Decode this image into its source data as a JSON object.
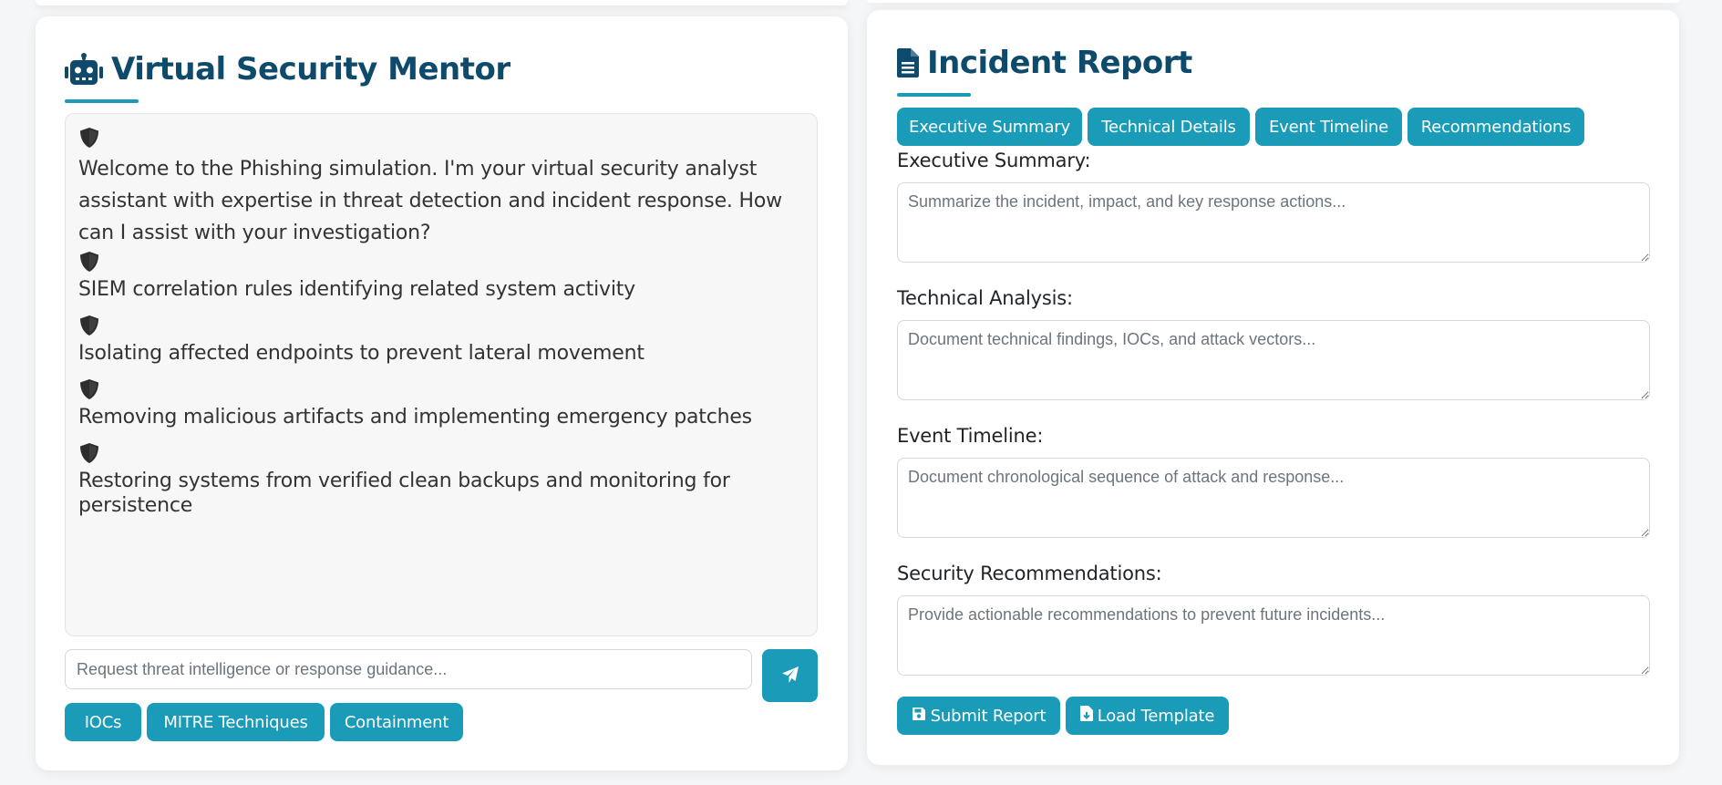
{
  "mentor": {
    "title": "Virtual Security Mentor",
    "messages": [
      {
        "avatar_icon": "shield-icon",
        "text": "Welcome to the Phishing simulation. I'm your virtual security analyst assistant with expertise in threat detection and incident response. How can I assist with your investigation?"
      },
      {
        "avatar_icon": "shield-icon",
        "text": "SIEM correlation rules identifying related system activity"
      },
      {
        "avatar_icon": "shield-icon",
        "text": "Isolating affected endpoints to prevent lateral movement"
      },
      {
        "avatar_icon": "shield-icon",
        "text": "Removing malicious artifacts and implementing emergency patches"
      },
      {
        "avatar_icon": "shield-icon",
        "text": "Restoring systems from verified clean backups and monitoring for persistence"
      }
    ],
    "input": {
      "value": "",
      "placeholder": "Request threat intelligence or response guidance..."
    },
    "send_icon": "paper-plane-icon",
    "quick_actions": [
      "IOCs",
      "MITRE Techniques",
      "Containment"
    ]
  },
  "report": {
    "title": "Incident Report",
    "tabs": [
      "Executive Summary",
      "Technical Details",
      "Event Timeline",
      "Recommendations"
    ],
    "fields": [
      {
        "label": "Executive Summary:",
        "placeholder": "Summarize the incident, impact, and key response actions...",
        "value": ""
      },
      {
        "label": "Technical Analysis:",
        "placeholder": "Document technical findings, IOCs, and attack vectors...",
        "value": ""
      },
      {
        "label": "Event Timeline:",
        "placeholder": "Document chronological sequence of attack and response...",
        "value": ""
      },
      {
        "label": "Security Recommendations:",
        "placeholder": "Provide actionable recommendations to prevent future incidents...",
        "value": ""
      }
    ],
    "submit_label": "Submit Report",
    "load_label": "Load Template"
  },
  "colors": {
    "accent": "#1a9bb8",
    "heading": "#0e4a6b",
    "chat_bg": "#f7f7f7"
  }
}
